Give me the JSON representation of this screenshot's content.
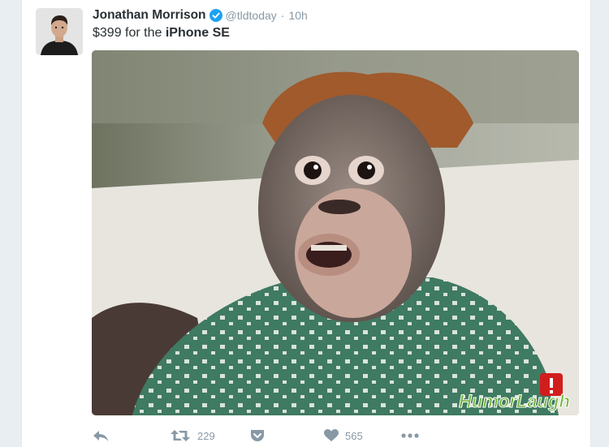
{
  "tweet": {
    "author": {
      "name": "Jonathan Morrison",
      "handle": "@tldtoday",
      "verified": true,
      "avatar_icon": "profile-photo"
    },
    "separator": "·",
    "time": "10h",
    "text": {
      "prefix": "$399 for the ",
      "emphasis": "iPhone SE"
    },
    "media": {
      "description_icon": "baby-orangutan-photo",
      "watermark": "HumorLaugh"
    },
    "actions": {
      "reply_icon": "reply-icon",
      "retweet_icon": "retweet-icon",
      "retweet_count": "229",
      "pocket_icon": "pocket-icon",
      "like_icon": "heart-icon",
      "like_count": "565",
      "more_icon": "more-icon"
    }
  },
  "colors": {
    "verified": "#1da1f2",
    "text": "#292f33",
    "muted": "#8899a6",
    "background": "#e9eef2"
  }
}
